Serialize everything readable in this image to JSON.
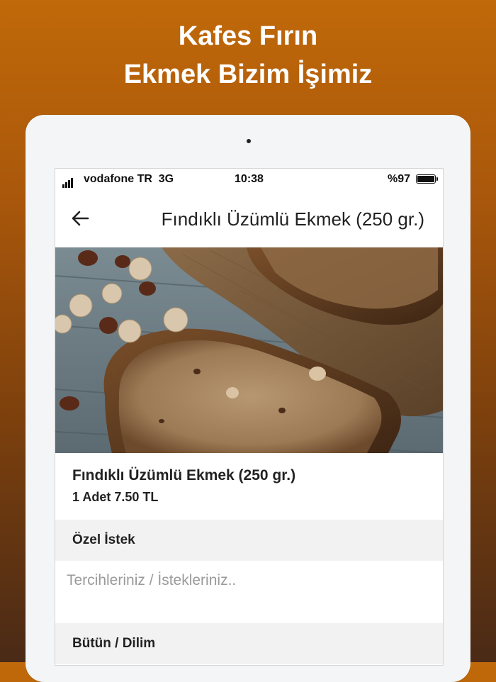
{
  "headline": {
    "line1": "Kafes Fırın",
    "line2": "Ekmek Bizim İşimiz"
  },
  "status_bar": {
    "carrier": "vodafone TR  3G",
    "time": "10:38",
    "battery": "%97"
  },
  "nav": {
    "back_icon": "back-arrow-icon",
    "title": "Fındıklı Üzümlü Ekmek (250 gr.)"
  },
  "product": {
    "image_subject": "sliced hazelnut raisin bread on burlap",
    "name": "Fındıklı Üzümlü Ekmek (250 gr.)",
    "price_line": "1 Adet 7.50 TL"
  },
  "special_request": {
    "heading": "Özel İstek",
    "placeholder": "Tercihleriniz / İstekleriniz.."
  },
  "cut_option": {
    "heading": "Bütün / Dilim"
  },
  "colors": {
    "background_top": "#c0690a",
    "background_bottom": "#4a2a16",
    "section_bg": "#f2f2f2"
  }
}
